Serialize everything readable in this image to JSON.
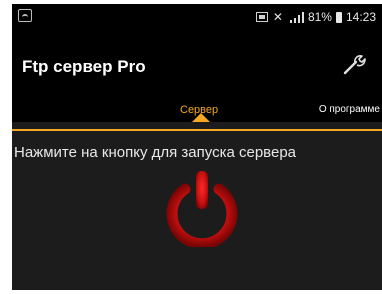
{
  "status_bar": {
    "battery_percent": "81%",
    "time": "14:23",
    "icons": [
      "notification-icon",
      "sd-card-icon",
      "mute-icon",
      "signal-icon",
      "battery-icon"
    ]
  },
  "app_bar": {
    "title": "Ftp сервер Pro",
    "settings_icon": "wrench-icon"
  },
  "tabs": [
    {
      "label": "Сервер",
      "active": true
    },
    {
      "label": "О программе",
      "active": false
    }
  ],
  "main": {
    "hint": "Нажмите на кнопку для запуска сервера",
    "power_button_icon": "power-icon"
  },
  "colors": {
    "accent": "#f4a723",
    "power_red": "#cc1111",
    "background": "#1c1c1c",
    "bar": "#000000"
  }
}
